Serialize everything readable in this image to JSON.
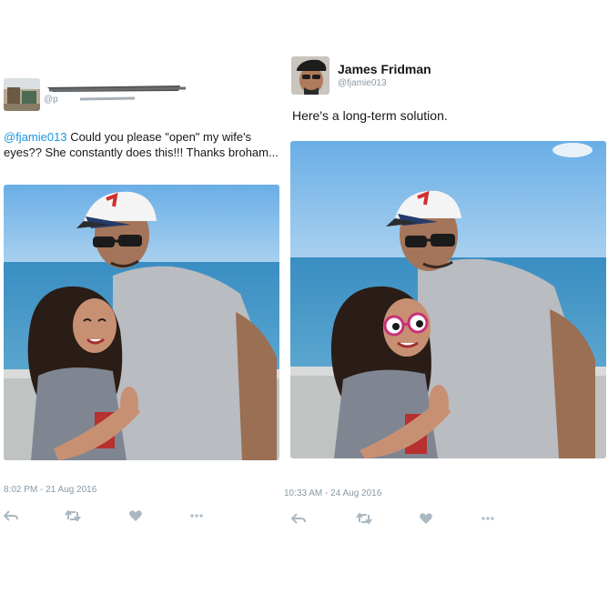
{
  "left_tweet": {
    "body": {
      "mention": "@fjamie013",
      "text": " Could you please \"open\" my wife's eyes?? She constantly does this!!! Thanks broham..."
    },
    "timestamp": "8:02 PM - 21 Aug 2016",
    "actions": [
      "reply-icon",
      "retweet-icon",
      "like-icon",
      "more-icon"
    ]
  },
  "right_tweet": {
    "author": {
      "name": "James Fridman",
      "handle": "@fjamie013"
    },
    "body": {
      "text": "Here's a long-term solution."
    },
    "timestamp": "10:33 AM - 24 Aug 2016",
    "actions": [
      "reply-icon",
      "retweet-icon",
      "like-icon",
      "more-icon"
    ]
  },
  "colors": {
    "link": "#1b95e0",
    "muted": "#8899a6",
    "text": "#14171a",
    "sky": "#7cb8e8",
    "sea": "#3d8fbf"
  }
}
